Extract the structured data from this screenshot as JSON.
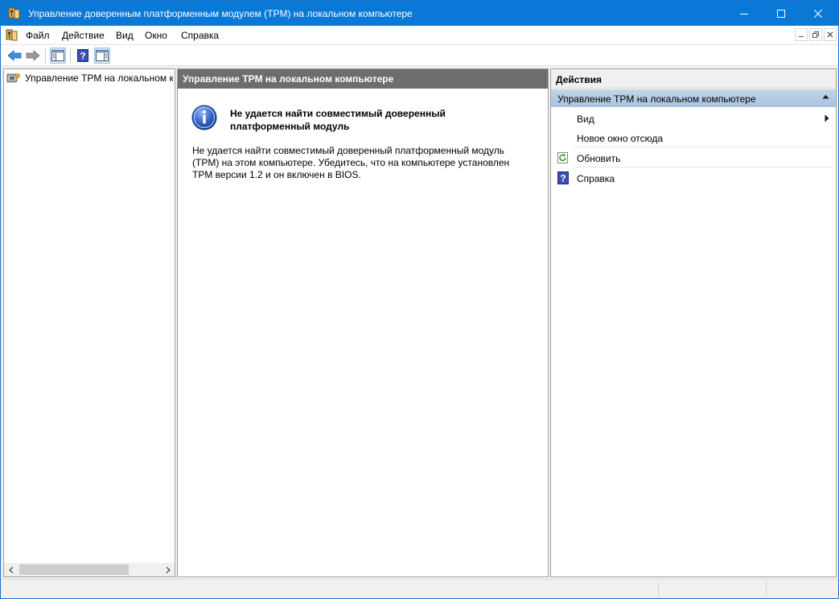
{
  "window": {
    "title": "Управление доверенным платформенным модулем (TPM) на локальном компьютере",
    "colors": {
      "titlebar": "#0a78d7",
      "pane_header": "#6d6d6d",
      "group_header": "#b6cbe5"
    }
  },
  "menu": {
    "items": [
      "Файл",
      "Действие",
      "Вид",
      "Окно",
      "Справка"
    ]
  },
  "toolbar": {
    "buttons": [
      "back-arrow-icon",
      "forward-arrow-icon",
      "show-hide-tree-icon",
      "help-icon",
      "show-hide-action-pane-icon"
    ]
  },
  "tree": {
    "root_label": "Управление TPM на локальном компьютере"
  },
  "center": {
    "header": "Управление TPM на локальном компьютере",
    "heading": "Не удается найти совместимый доверенный платформенный модуль",
    "body": "Не удается найти совместимый доверенный платформенный модуль (TPM) на этом компьютере. Убедитесь, что на компьютере установлен TPM версии 1.2 и он включен в BIOS."
  },
  "actions": {
    "header": "Действия",
    "group_label": "Управление TPM на локальном компьютере",
    "items": [
      {
        "label": "Вид",
        "icon": "",
        "submenu": true
      },
      {
        "label": "Новое окно отсюда",
        "icon": ""
      },
      {
        "label": "Обновить",
        "icon": "refresh-icon"
      },
      {
        "label": "Справка",
        "icon": "help-icon"
      }
    ]
  }
}
